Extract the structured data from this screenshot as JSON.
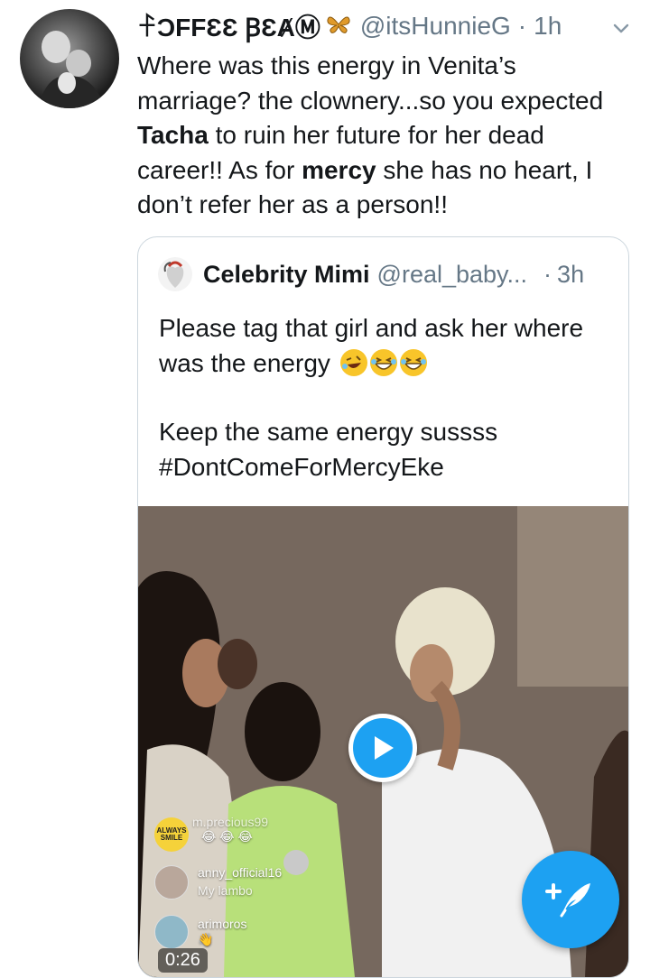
{
  "tweet": {
    "display_name": "ꊰƆFFƐƐ ꞴƐȺⓂ",
    "butterfly_icon": "butterfly-emoji",
    "handle": "@itsHunnieG",
    "separator": "·",
    "time": "1h",
    "text_parts": [
      "Where was this energy in Venita’s marriage? the clownery...so you expected ",
      "Tacha",
      " to ruin her future for her dead career!! As for ",
      "mercy",
      " she has no heart, I don’t refer her as a person!!"
    ]
  },
  "quoted_tweet": {
    "display_name": "Celebrity Mimi",
    "handle": "@real_baby...",
    "separator": "·",
    "time": "3h",
    "line1": "Please tag that girl and ask her where was the energy",
    "emoji_icons": [
      "rolling-on-floor-laughing-emoji",
      "grinning-squinting-emoji",
      "grinning-squinting-emoji"
    ],
    "line2": "Keep the same energy sussss",
    "hashtag": "#DontComeForMercyEke",
    "video": {
      "duration": "0:26",
      "badge_text": "ALWAYS SMILE",
      "comments": [
        {
          "user": "m.precious99",
          "text": "😂 😂 😂"
        },
        {
          "user": "anny_official16",
          "text": "My lambo"
        },
        {
          "user": "arimoros",
          "text": "👋"
        }
      ]
    }
  },
  "compose_button": {
    "icon": "compose-feather-icon"
  },
  "colors": {
    "accent": "#1da1f2",
    "secondary_text": "#657786",
    "border": "#ccd6dd"
  }
}
